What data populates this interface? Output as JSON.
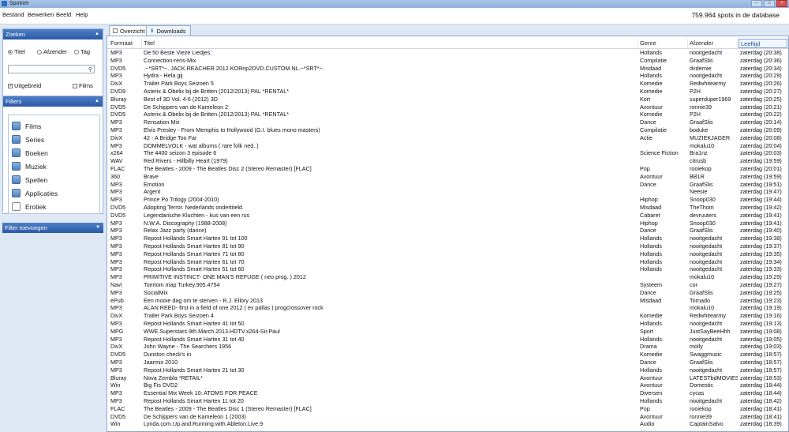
{
  "window": {
    "title": "Spotnet"
  },
  "menu": {
    "items": [
      "Bestand",
      "Bewerken",
      "Beeld",
      "Help"
    ],
    "spot_count": "759.964 spots in de database"
  },
  "search": {
    "header": "Zoeken",
    "radio_titel": "Titel",
    "radio_afzender": "Afzender",
    "radio_tag": "Tag",
    "input_value": "",
    "check_uitgebreid": "Uitgebreid",
    "check_films": "Films"
  },
  "filters": {
    "header": "Filters",
    "items": [
      "Films",
      "Series",
      "Boeken",
      "Muziek",
      "Spellen",
      "Applicaties",
      "Erotiek"
    ],
    "add_label": "Filter toevoegen"
  },
  "tabs": {
    "overzicht": "Overzicht",
    "downloads": "Downloads"
  },
  "columns": {
    "formaat": "Formaat",
    "titel": "Titel",
    "genre": "Genre",
    "afzender": "Afzender",
    "leeftijd": "Leeftijd"
  },
  "rows": [
    [
      "MP3",
      "De 50 Beste Vieze Liedjes",
      "Hollands",
      "nooitgedacht",
      "zaterdag (20:38)"
    ],
    [
      "MP3",
      "Connection-rens-Mix",
      "Compilatie",
      "GraafSlis",
      "zaterdag (20:36)"
    ],
    [
      "DVD5",
      ".~*SRT*~. JACK.REACHER.2012 KORrip2DVD.CUSTOM.NL.~*SRT*~.",
      "Misdaad",
      "dvdernie",
      "zaterdag (20:34)"
    ],
    [
      "MP3",
      "Hydra - Hela gij",
      "Hollands",
      "nooitgedacht",
      "zaterdag (20:29)"
    ],
    [
      "DivX",
      "Trailer Park Boys Seizoen 5",
      "Komedie",
      "Redwhitearmy",
      "zaterdag (20:26)"
    ],
    [
      "DVD9",
      "Asterix & Obelix bij de Britten (2012/2013) PAL *RENTAL*",
      "Komedie",
      "P2H",
      "zaterdag (20:27)"
    ],
    [
      "Bluray",
      "Best of 3D Vol. 4-6 (2012) 3D",
      "Kort",
      "superduper1969",
      "zaterdag (20:25)"
    ],
    [
      "DVD5",
      "De Schippers van de Kameleon 2",
      "Avontuur",
      "ronnie39",
      "zaterdag (20:21)"
    ],
    [
      "DVD5",
      "Asterix & Obelix bij de Britten (2012/2013) PAL *RENTAL*",
      "Komedie",
      "P2H",
      "zaterdag (20:22)"
    ],
    [
      "MP3",
      "Rensation Mix",
      "Dance",
      "GraafSlis",
      "zaterdag (20:14)"
    ],
    [
      "MP3",
      "Elvis Presley - From Memphis to Hollywood (G.I. blues mono masters)",
      "Compilatie",
      "boduke",
      "zaterdag (20:09)"
    ],
    [
      "DivX",
      "42 - A Bridge Too Far",
      "Actie",
      "MUZIEKJAGER",
      "zaterdag (20:08)"
    ],
    [
      "MP3",
      "DOMMELVOLK - wat albums ( rare folk ned. )",
      "",
      "mokalu10",
      "zaterdag (20:04)"
    ],
    [
      "x264",
      "The 4400 seizon 3 episode 6",
      "Science Fiction",
      "Bra1nz",
      "zaterdag (20:03)"
    ],
    [
      "WAV",
      "Red Rivers - Hillbilly Heart (1979)",
      "",
      "citrusb",
      "zaterdag (19:59)"
    ],
    [
      "FLAC",
      "The Beatles - 2009 - The Beatles Disc 2 (Stereo Remaster) [FLAC]",
      "Pop",
      "rooiekop",
      "zaterdag (20:01)"
    ],
    [
      "360",
      "Brave",
      "Avontuur",
      "BB1R",
      "zaterdag (19:59)"
    ],
    [
      "MP3",
      "Emotion",
      "Dance",
      "GraafSlis",
      "zaterdag (19:51)"
    ],
    [
      "MP3",
      "Argent",
      "",
      "Neesie",
      "zaterdag (19:47)"
    ],
    [
      "MP3",
      "Prince Po Trilogy (2004-2010)",
      "Hiphop",
      "Snoop030",
      "zaterdag (19:44)"
    ],
    [
      "DVD5",
      "Adopting Terror. Nederlands ondertiteld.",
      "Misdaad",
      "TheThom",
      "zaterdag (19:42)"
    ],
    [
      "DVD5",
      "Legendarische Kluchten - kus van een rus",
      "Cabaret",
      "devruuters",
      "zaterdag (19:41)"
    ],
    [
      "MP3",
      "N.W.A. Discography (1988-2008)",
      "Hiphop",
      "Snoop030",
      "zaterdag (19:41)"
    ],
    [
      "MP3",
      "Relax Jazz party (dance)",
      "Dance",
      "GraafSlis",
      "zaterdag (19:40)"
    ],
    [
      "MP3",
      "Repost Hollands Smart Harten 91 tot 100",
      "Hollands",
      "nooitgedacht",
      "zaterdag (19:38)"
    ],
    [
      "MP3",
      "Repost Hollands Smart Harten 81 tot 90",
      "Hollands",
      "nooitgedacht",
      "zaterdag (19:37)"
    ],
    [
      "MP3",
      "Repost Hollands Smart Harten 71 tot 80",
      "Hollands",
      "nooitgedacht",
      "zaterdag (19:35)"
    ],
    [
      "MP3",
      "Repost Hollands Smart Harten 61 tot 70",
      "Hollands",
      "nooitgedacht",
      "zaterdag (19:34)"
    ],
    [
      "MP3",
      "Repost Hollands Smart Harten 51 tot 60",
      "Hollands",
      "nooitgedacht",
      "zaterdag (19:33)"
    ],
    [
      "MP3",
      "PRIMITIVE INSTINCT- ONE MAN'S REFUGE ( neo prog. ) 2012",
      "",
      "mokalu10",
      "zaterdag (19:29)"
    ],
    [
      "Navi",
      "Tomtom map Turkey.905.4754",
      "Systeem",
      "cor",
      "zaterdag (19:27)"
    ],
    [
      "MP3",
      "SocialMix",
      "Dance",
      "GraafSlis",
      "zaterdag (19:25)"
    ],
    [
      "ePub",
      "Een mooie dag om te sterven - R.J. Ellory 2013",
      "Misdaad",
      "Tornado",
      "zaterdag (19:23)"
    ],
    [
      "MP3",
      "ALAN REED- first in a field of one 2012 ( ex pallas ) progcrossover rock",
      "",
      "mokalu10",
      "zaterdag (19:19)"
    ],
    [
      "DivX",
      "Trailer Park Boys Seizoen 4",
      "Komedie",
      "Redwhitearmy",
      "zaterdag (19:16)"
    ],
    [
      "MP3",
      "Repost Hollands Smart Harten 41 tot 50",
      "Hollands",
      "nooitgedacht",
      "zaterdag (19:13)"
    ],
    [
      "MPG",
      "WWE.Superstars.9th.March.2013.HDTV.x264-Sir.Paul",
      "Sport",
      "JustSayBeeHhh",
      "zaterdag (19:08)"
    ],
    [
      "MP3",
      "Repost Hollands Smart Harten 31 tot 40",
      "Hollands",
      "nooitgedacht",
      "zaterdag (19:05)"
    ],
    [
      "DivX",
      "John Wayne - The Searchers 1956",
      "Drama",
      "molly",
      "zaterdag (19:03)"
    ],
    [
      "DVD5",
      "Dunston check's in",
      "Komedie",
      "Swaggmusic",
      "zaterdag (18:57)"
    ],
    [
      "MP3",
      "Jaarmix 2010",
      "Dance",
      "GraafSlis",
      "zaterdag (18:57)"
    ],
    [
      "MP3",
      "Repost Hollands Smart Harten 21 tot 30",
      "Hollands",
      "nooitgedacht",
      "zaterdag (18:57)"
    ],
    [
      "Bluray",
      "Nova Zembla *RETAIL*",
      "Avontuur",
      "LATESTbdMOVIES",
      "zaterdag (18:53)"
    ],
    [
      "Win",
      "Big Fis DVD2",
      "Avontuur",
      "Domestic",
      "zaterdag (18:44)"
    ],
    [
      "MP3",
      "Essential Mix Week 10: ATOMS FOR PEACE",
      "Diversen",
      "cycas",
      "zaterdag (18:44)"
    ],
    [
      "MP3",
      "Repost Hollands Smart Harten 11 tot 20",
      "Hollands",
      "nooitgedacht",
      "zaterdag (18:42)"
    ],
    [
      "FLAC",
      "The Beatles - 2009 - The Beatles Disc 1 (Stereo Remaster) [FLAC]",
      "Pop",
      "rooiekop",
      "zaterdag (18:41)"
    ],
    [
      "DVD5",
      "De Schippers van de Kameleon 1 (2003)",
      "Avontuur",
      "ronnie39",
      "zaterdag (18:41)"
    ],
    [
      "Win",
      "Lynda.com.Up.and.Running.with.Ableton.Live.9",
      "Audio",
      "CaptainSalvo",
      "zaterdag (18:39)"
    ]
  ]
}
